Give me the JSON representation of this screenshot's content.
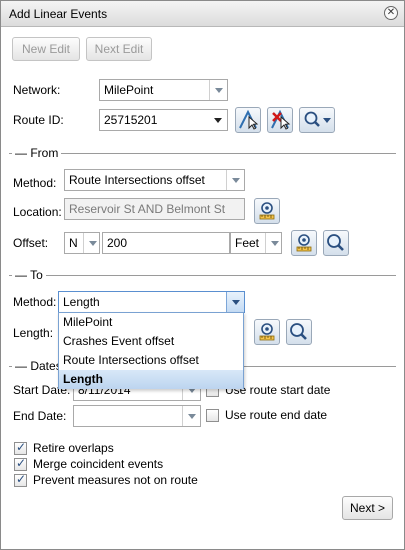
{
  "window": {
    "title": "Add Linear Events"
  },
  "toolbar": {
    "new_edit": "New Edit",
    "next_edit": "Next Edit"
  },
  "network": {
    "label": "Network:",
    "value": "MilePoint"
  },
  "route": {
    "label": "Route ID:",
    "value": "25715201"
  },
  "from": {
    "section": "From",
    "method_label": "Method:",
    "method_value": "Route Intersections offset",
    "location_label": "Location:",
    "location_value": "Reservoir St AND Belmont St",
    "offset_label": "Offset:",
    "offset_direction": "N",
    "offset_value": "200",
    "offset_unit": "Feet"
  },
  "to": {
    "section": "To",
    "method_label": "Method:",
    "method_value": "Length",
    "length_label": "Length:",
    "options": [
      "MilePoint",
      "Crashes Event offset",
      "Route Intersections offset",
      "Length"
    ],
    "selected_option": "Length"
  },
  "dates": {
    "section": "Dates",
    "start_label": "Start Date:",
    "start_value": "8/11/2014",
    "use_start": "Use route start date",
    "end_label": "End Date:",
    "end_value": "",
    "use_end": "Use route end date"
  },
  "options": {
    "retire": "Retire overlaps",
    "merge": "Merge coincident events",
    "prevent": "Prevent measures not on route"
  },
  "footer": {
    "next": "Next >"
  },
  "icons": [
    "close-icon",
    "select-route-icon",
    "clear-route-icon",
    "zoom-dropdown-icon",
    "location-pick-icon",
    "zoom-to-icon"
  ],
  "colors": {
    "accent": "#3a6fb5",
    "selected_row": "#c4dbf4"
  }
}
